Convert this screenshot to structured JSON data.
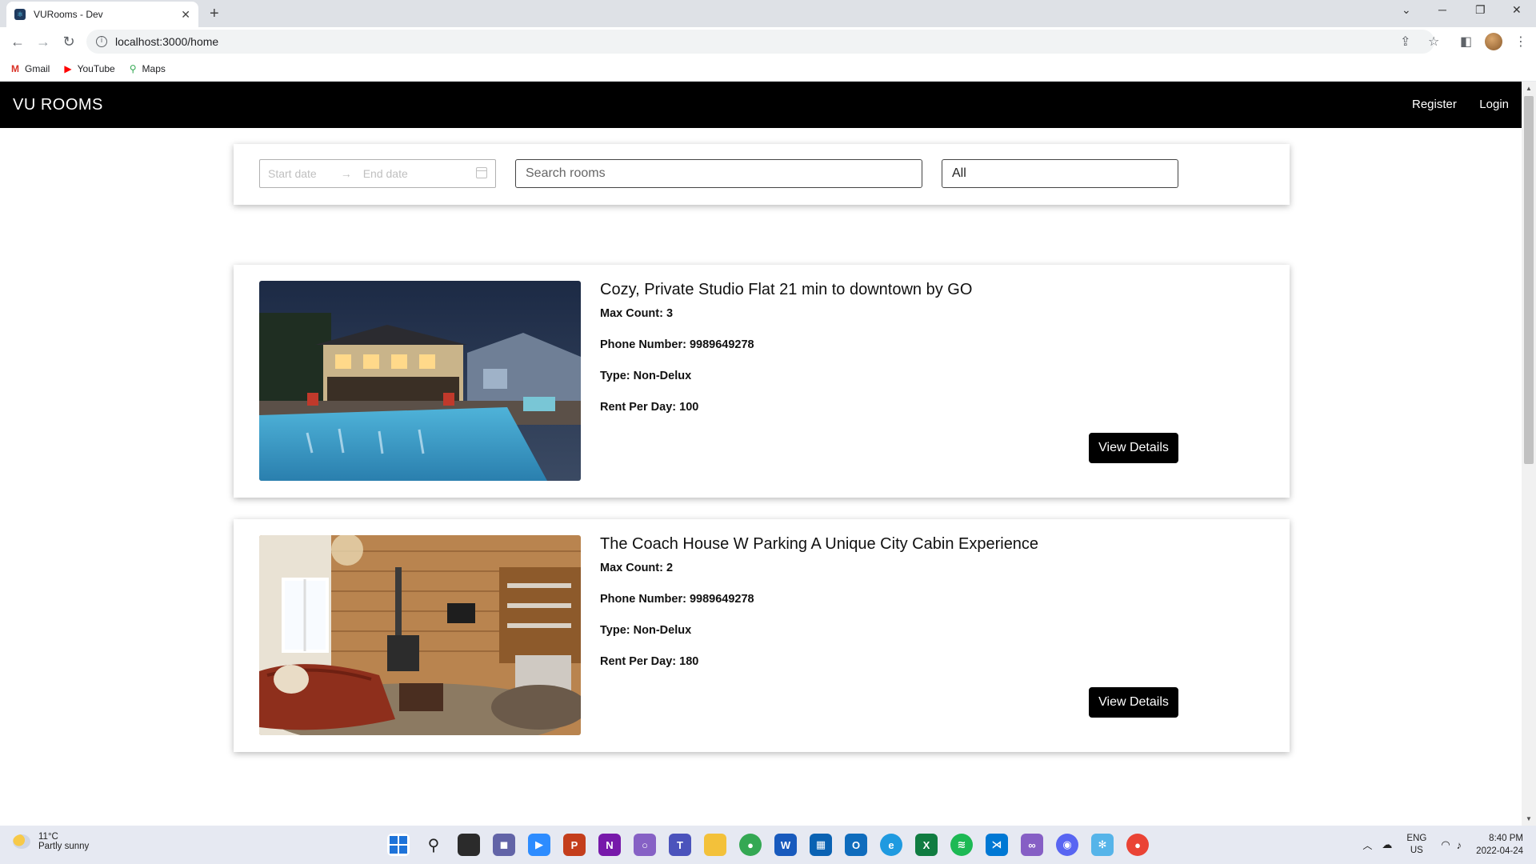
{
  "browser": {
    "tab_title": "VURooms - Dev",
    "tab_close": "✕",
    "new_tab": "+",
    "url": "localhost:3000/home",
    "bookmarks": [
      {
        "label": "Gmail",
        "icon": "gmail-icon",
        "glyph": "M",
        "color": "#d93025"
      },
      {
        "label": "YouTube",
        "icon": "youtube-icon",
        "glyph": "▶",
        "color": "#ff0000"
      },
      {
        "label": "Maps",
        "icon": "maps-icon",
        "glyph": "⚲",
        "color": "#34a853"
      }
    ]
  },
  "app": {
    "brand": "VU ROOMS",
    "nav": {
      "register": "Register",
      "login": "Login"
    }
  },
  "filters": {
    "start_placeholder": "Start date",
    "end_placeholder": "End date",
    "separator": "→",
    "search_placeholder": "Search rooms",
    "type_selected": "All"
  },
  "rooms": [
    {
      "title": "Cozy, Private Studio Flat 21 min to downtown by GO",
      "max_count_label": "Max Count:",
      "max_count": "3",
      "phone_label": "Phone Number:",
      "phone": "9989649278",
      "type_label": "Type:",
      "type": "Non-Delux",
      "rent_label": "Rent Per Day:",
      "rent": "100",
      "button": "View Details"
    },
    {
      "title": "The Coach House W Parking A Unique City Cabin Experience",
      "max_count_label": "Max Count:",
      "max_count": "2",
      "phone_label": "Phone Number:",
      "phone": "9989649278",
      "type_label": "Type:",
      "type": "Non-Delux",
      "rent_label": "Rent Per Day:",
      "rent": "180",
      "button": "View Details"
    }
  ],
  "taskbar": {
    "temperature": "11°C",
    "weather": "Partly sunny",
    "lang_top": "ENG",
    "lang_bottom": "US",
    "time": "8:40 PM",
    "date": "2022-04-24"
  },
  "colors": {
    "navbar": "#000000",
    "button": "#000000"
  }
}
